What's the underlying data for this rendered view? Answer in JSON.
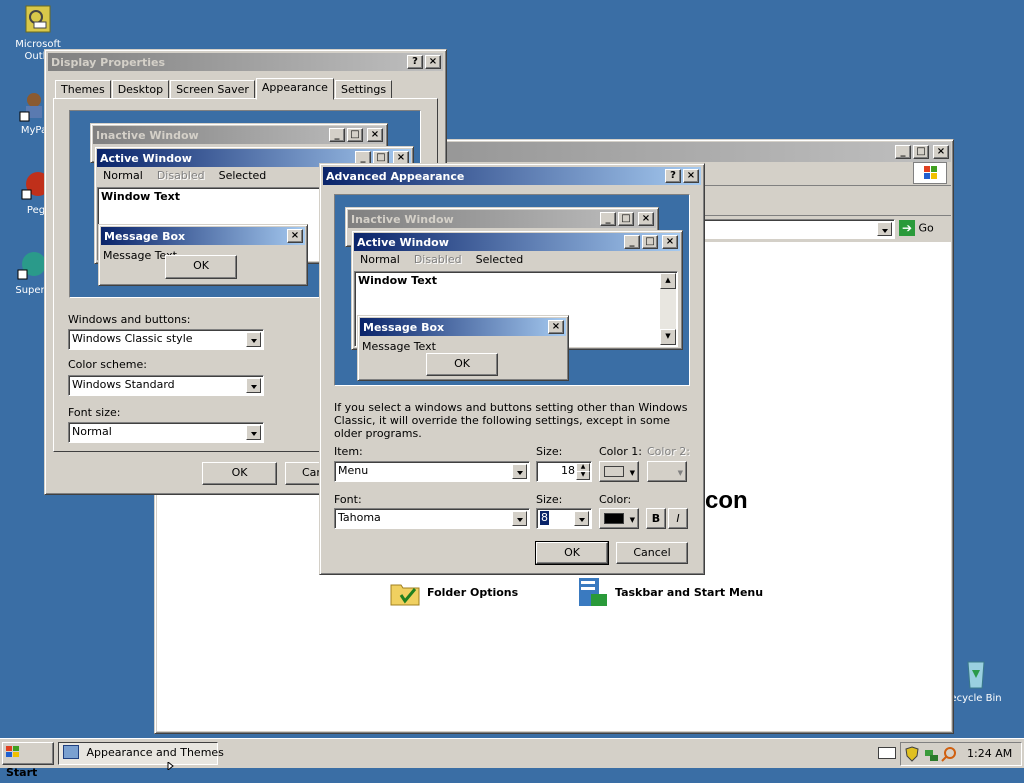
{
  "desktop": {
    "icons": [
      {
        "label": "Microsoft",
        "label2": "Outlo"
      },
      {
        "label": "MyPa"
      },
      {
        "label": "Peg"
      },
      {
        "label": "Superr"
      },
      {
        "label": "ecycle Bin"
      }
    ]
  },
  "control_panel": {
    "address_go": "Go",
    "heading_fragment": "con",
    "items": [
      {
        "label": "Folder Options",
        "icon": "folder-options-icon"
      },
      {
        "label": "Taskbar and Start Menu",
        "icon": "taskbar-icon"
      }
    ]
  },
  "display_properties": {
    "title": "Display Properties",
    "tabs": [
      "Themes",
      "Desktop",
      "Screen Saver",
      "Appearance",
      "Settings"
    ],
    "selected_tab": "Appearance",
    "preview": {
      "inactive_title": "Inactive Window",
      "active_title": "Active Window",
      "menu": [
        "Normal",
        "Disabled",
        "Selected"
      ],
      "window_text": "Window Text",
      "msgbox_title": "Message Box",
      "msgbox_text": "Message Text",
      "msgbox_ok": "OK"
    },
    "windows_buttons_label": "Windows and buttons:",
    "windows_buttons_value": "Windows Classic style",
    "color_scheme_label": "Color scheme:",
    "color_scheme_value": "Windows Standard",
    "font_size_label": "Font size:",
    "font_size_value": "Normal",
    "ok": "OK",
    "cancel_fragment": "Car"
  },
  "advanced_appearance": {
    "title": "Advanced Appearance",
    "preview": {
      "inactive_title": "Inactive Window",
      "active_title": "Active Window",
      "menu": [
        "Normal",
        "Disabled",
        "Selected"
      ],
      "window_text": "Window Text",
      "msgbox_title": "Message Box",
      "msgbox_text": "Message Text",
      "msgbox_ok": "OK"
    },
    "note": "If you select a windows and buttons setting other than Windows Classic, it will override the following settings, except in some older programs.",
    "item_label": "Item:",
    "item_value": "Menu",
    "size_label": "Size:",
    "size_value": "18",
    "color1_label": "Color 1:",
    "color2_label": "Color 2:",
    "font_label": "Font:",
    "font_value": "Tahoma",
    "font_size_label": "Size:",
    "font_size_value": "8",
    "font_color_label": "Color:",
    "bold": "B",
    "italic": "I",
    "ok": "OK",
    "cancel": "Cancel",
    "colors": {
      "color1": "#d4d0c8",
      "font_color": "#000000"
    }
  },
  "taskbar": {
    "start": "Start",
    "task": "Appearance and Themes",
    "clock": "1:24 AM"
  },
  "colors": {
    "desktop": "#3a6ea5",
    "active_title_start": "#0a246a",
    "active_title_end": "#a6caf0",
    "face": "#d4d0c8"
  }
}
